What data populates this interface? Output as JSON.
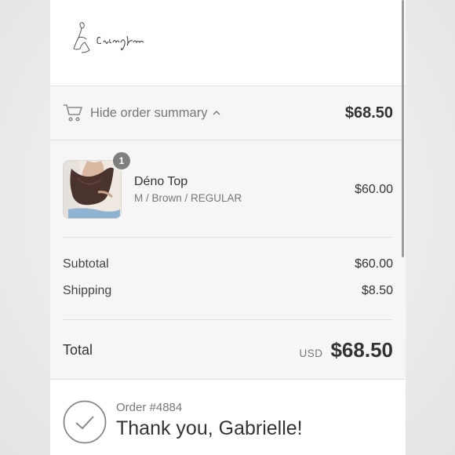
{
  "shop": {
    "logo_icon": "handwritten-signature-logo",
    "logo_text": "Embrace Kairos"
  },
  "summary_toggle": {
    "icon": "cart-icon",
    "label": "Hide order summary",
    "chevron_icon": "chevron-up-icon",
    "total": "$68.50"
  },
  "products": [
    {
      "name": "Déno Top",
      "variant": "M / Brown / REGULAR",
      "price": "$60.00",
      "quantity": "1"
    }
  ],
  "subtotal": {
    "label": "Subtotal",
    "value": "$60.00"
  },
  "shipping": {
    "label": "Shipping",
    "value": "$8.50"
  },
  "total": {
    "label": "Total",
    "currency": "USD",
    "value": "$68.50"
  },
  "confirmation": {
    "icon": "check-circle-icon",
    "order_number": "Order #4884",
    "title": "Thank you, Gabrielle!"
  },
  "colors": {
    "summary_bg": "#f6f6f6",
    "text": "#333333",
    "muted": "#777777",
    "badge": "#7e7e7e"
  }
}
